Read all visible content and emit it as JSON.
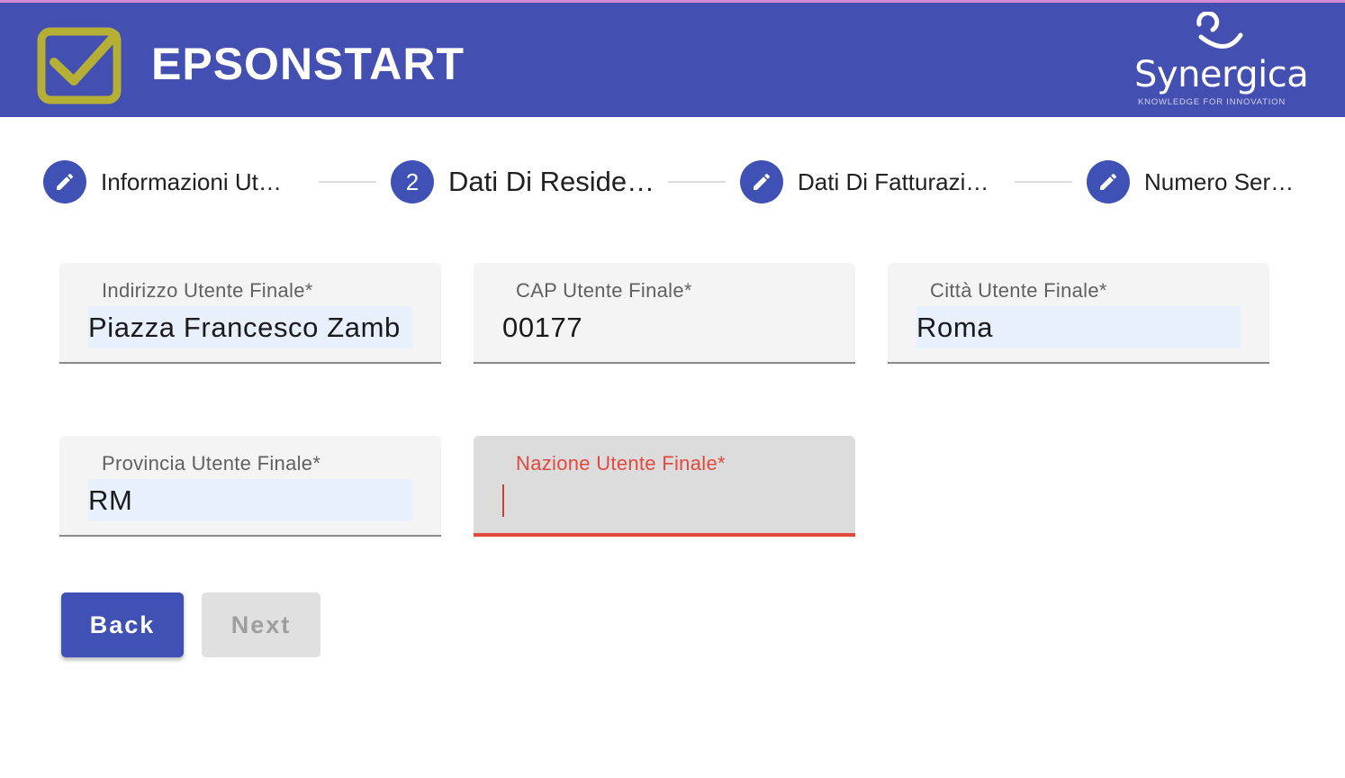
{
  "header": {
    "app_title": "EPSONSTART",
    "app_logo_icon": "checkbox-check-icon",
    "brand_name": "Synergica",
    "brand_tagline": "KNOWLEDGE FOR INNOVATION",
    "colors": {
      "toolbar": "#4450b1",
      "logo": "#b5b035",
      "accent": "#3f51b5"
    }
  },
  "stepper": {
    "steps": [
      {
        "label": "Informazioni Ut…",
        "icon": "pencil-icon",
        "state": "edit"
      },
      {
        "label": "Dati Di Reside…",
        "number": "2",
        "state": "active"
      },
      {
        "label": "Dati Di Fatturazi…",
        "icon": "pencil-icon",
        "state": "edit"
      },
      {
        "label": "Numero Ser…",
        "icon": "pencil-icon",
        "state": "edit"
      }
    ]
  },
  "form": {
    "indirizzo": {
      "label": "Indirizzo Utente Finale*",
      "value": "Piazza Francesco Zamb"
    },
    "cap": {
      "label": "CAP Utente Finale*",
      "value": "00177"
    },
    "citta": {
      "label": "Città Utente Finale*",
      "value": "Roma"
    },
    "provincia": {
      "label": "Provincia Utente Finale*",
      "value": "RM"
    },
    "nazione": {
      "label": "Nazione Utente Finale*",
      "value": "",
      "state": "invalid",
      "error_color": "#e2493e"
    }
  },
  "actions": {
    "back_label": "Back",
    "next_label": "Next"
  }
}
